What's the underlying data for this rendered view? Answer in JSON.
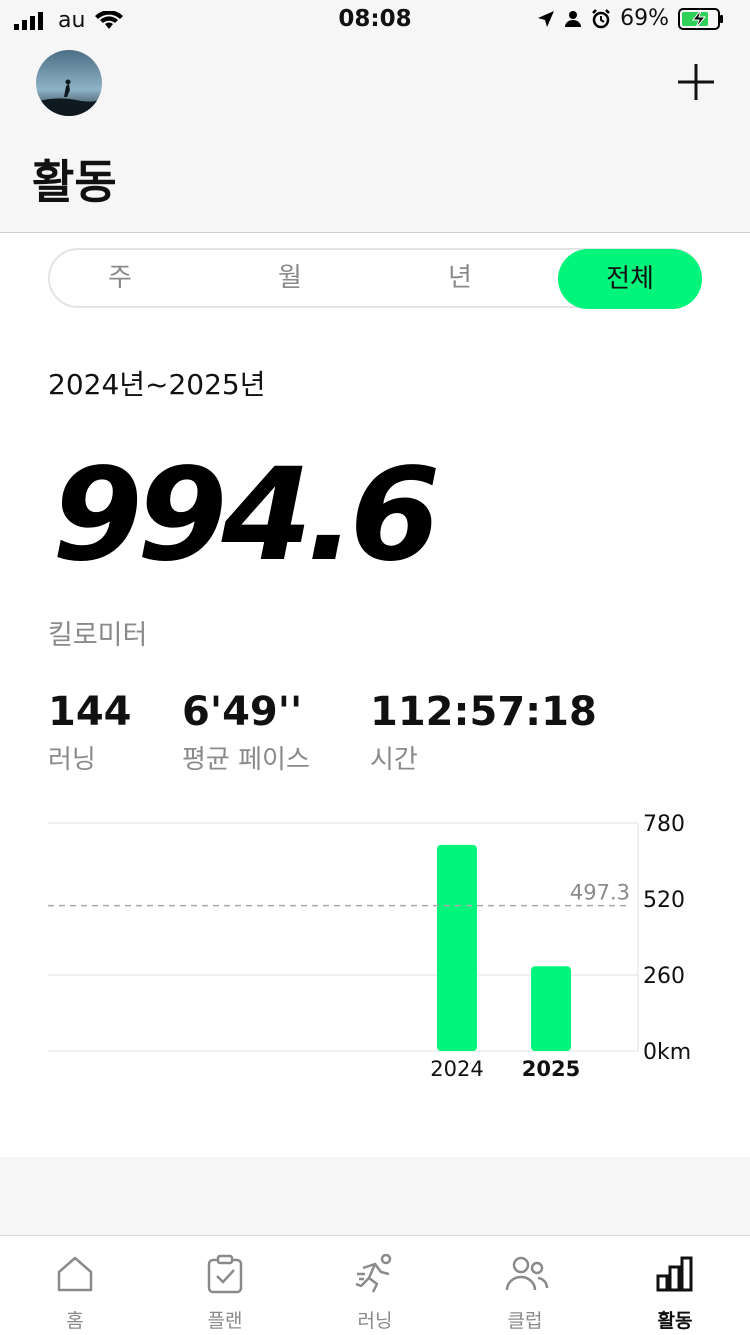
{
  "status_bar": {
    "carrier": "au",
    "time": "08:08",
    "battery_percent": "69%",
    "icons": [
      "signal-icon",
      "wifi-icon",
      "location-arrow-icon",
      "person-icon",
      "alarm-icon",
      "battery-charging-icon"
    ]
  },
  "header": {
    "title": "활동",
    "add_icon": "plus-icon"
  },
  "segment": {
    "items": [
      "주",
      "월",
      "년",
      "전체"
    ],
    "selected": "전체"
  },
  "summary": {
    "date_range": "2024년~2025년",
    "distance": "994.6",
    "distance_unit": "킬로미터",
    "runs_value": "144",
    "runs_label": "러닝",
    "pace_value": "6'49''",
    "pace_label": "평균 페이스",
    "time_value": "112:57:18",
    "time_label": "시간"
  },
  "chart_data": {
    "type": "bar",
    "categories": [
      "2024",
      "2025"
    ],
    "values": [
      705,
      290
    ],
    "y_tick_labels": [
      "0km",
      "260",
      "520",
      "780"
    ],
    "y_ticks": [
      0,
      260,
      520,
      780
    ],
    "ylim": [
      0,
      780
    ],
    "average": 497.3,
    "average_label": "497.3",
    "bar_color": "#00f57a",
    "selected_category": "2025"
  },
  "tabbar": {
    "items": [
      {
        "label": "홈",
        "icon": "home-icon"
      },
      {
        "label": "플랜",
        "icon": "clipboard-check-icon"
      },
      {
        "label": "러닝",
        "icon": "runner-icon"
      },
      {
        "label": "클럽",
        "icon": "people-icon"
      },
      {
        "label": "활동",
        "icon": "bar-chart-icon"
      }
    ],
    "active": "활동"
  },
  "colors": {
    "accent": "#00f57a",
    "muted_text": "#8a8a8a"
  }
}
